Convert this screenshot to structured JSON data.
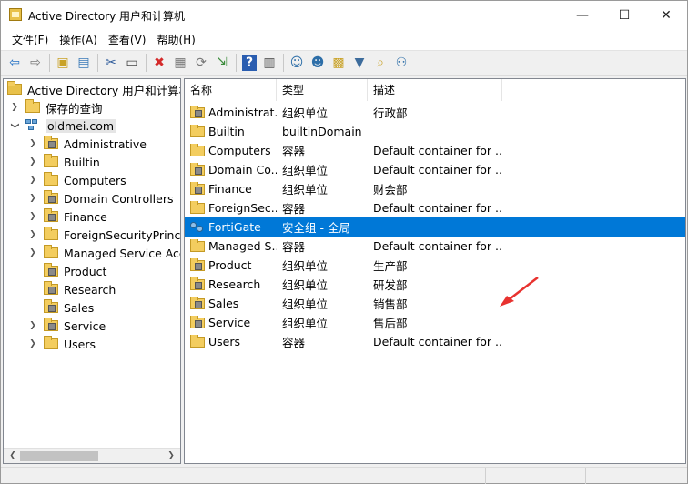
{
  "window": {
    "title": "Active Directory 用户和计算机",
    "controls": {
      "minimize": "—",
      "maximize": "☐",
      "close": "✕"
    }
  },
  "menu": [
    "文件(F)",
    "操作(A)",
    "查看(V)",
    "帮助(H)"
  ],
  "toolbar": {
    "buttons": [
      {
        "name": "back",
        "glyph": "⇦"
      },
      {
        "name": "forward",
        "glyph": "⇨"
      },
      {
        "name": "up",
        "glyph": "▣"
      },
      {
        "name": "show-tree",
        "glyph": "▤"
      },
      {
        "name": "cut",
        "glyph": "✂"
      },
      {
        "name": "copy",
        "glyph": "▭"
      },
      {
        "name": "delete",
        "glyph": "✖"
      },
      {
        "name": "properties",
        "glyph": "▦"
      },
      {
        "name": "refresh",
        "glyph": "⟳"
      },
      {
        "name": "export",
        "glyph": "⇲"
      },
      {
        "name": "help",
        "glyph": "?"
      },
      {
        "name": "console",
        "glyph": "▥"
      },
      {
        "name": "new-user",
        "glyph": "☺"
      },
      {
        "name": "new-group",
        "glyph": "☻"
      },
      {
        "name": "new-ou",
        "glyph": "▩"
      },
      {
        "name": "filter",
        "glyph": "▼"
      },
      {
        "name": "find",
        "glyph": "⌕"
      },
      {
        "name": "add-to-group",
        "glyph": "⚇"
      }
    ]
  },
  "tree": {
    "root": "Active Directory 用户和计算机",
    "saved_queries": "保存的查询",
    "domain": "oldmei.com",
    "children": [
      {
        "label": "Administrative",
        "type": "ou",
        "expandable": true
      },
      {
        "label": "Builtin",
        "type": "folder",
        "expandable": true
      },
      {
        "label": "Computers",
        "type": "folder",
        "expandable": true
      },
      {
        "label": "Domain Controllers",
        "type": "ou",
        "expandable": true
      },
      {
        "label": "Finance",
        "type": "ou",
        "expandable": true
      },
      {
        "label": "ForeignSecurityPrincipals",
        "type": "folder",
        "expandable": true
      },
      {
        "label": "Managed Service Accounts",
        "type": "folder",
        "expandable": true
      },
      {
        "label": "Product",
        "type": "ou",
        "expandable": false
      },
      {
        "label": "Research",
        "type": "ou",
        "expandable": false
      },
      {
        "label": "Sales",
        "type": "ou",
        "expandable": false
      },
      {
        "label": "Service",
        "type": "ou",
        "expandable": true
      },
      {
        "label": "Users",
        "type": "folder",
        "expandable": true
      }
    ]
  },
  "list": {
    "columns": [
      "名称",
      "类型",
      "描述"
    ],
    "rows": [
      {
        "name": "Administrat...",
        "type": "组织单位",
        "desc": "行政部",
        "icon": "ou"
      },
      {
        "name": "Builtin",
        "type": "builtinDomain",
        "desc": "",
        "icon": "folder"
      },
      {
        "name": "Computers",
        "type": "容器",
        "desc": "Default container for ...",
        "icon": "folder"
      },
      {
        "name": "Domain Co...",
        "type": "组织单位",
        "desc": "Default container for ...",
        "icon": "ou"
      },
      {
        "name": "Finance",
        "type": "组织单位",
        "desc": "财会部",
        "icon": "ou"
      },
      {
        "name": "ForeignSec...",
        "type": "容器",
        "desc": "Default container for ...",
        "icon": "folder"
      },
      {
        "name": "FortiGate",
        "type": "安全组 - 全局",
        "desc": "",
        "icon": "group",
        "selected": true
      },
      {
        "name": "Managed S...",
        "type": "容器",
        "desc": "Default container for ...",
        "icon": "folder"
      },
      {
        "name": "Product",
        "type": "组织单位",
        "desc": "生产部",
        "icon": "ou"
      },
      {
        "name": "Research",
        "type": "组织单位",
        "desc": "研发部",
        "icon": "ou"
      },
      {
        "name": "Sales",
        "type": "组织单位",
        "desc": "销售部",
        "icon": "ou"
      },
      {
        "name": "Service",
        "type": "组织单位",
        "desc": "售后部",
        "icon": "ou"
      },
      {
        "name": "Users",
        "type": "容器",
        "desc": "Default container for ...",
        "icon": "folder"
      }
    ]
  },
  "colors": {
    "selection": "#0078d7",
    "annotation_arrow": "#e8322f"
  }
}
